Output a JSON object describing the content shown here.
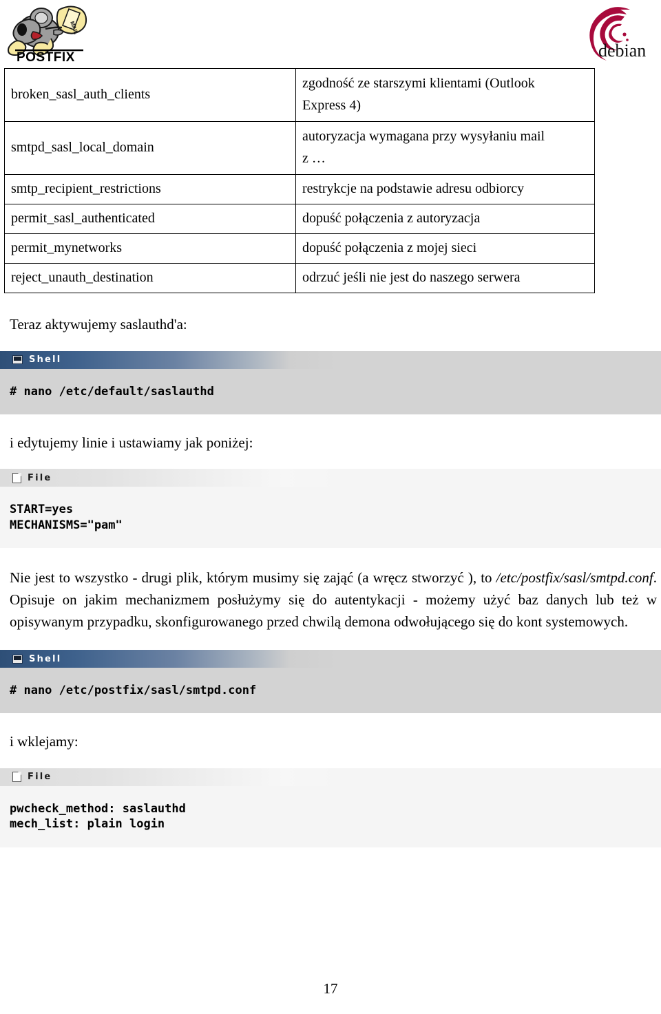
{
  "header": {
    "postfix_logo_alt": "POSTFIX",
    "postfix_wordmark": "POSTFIX",
    "postfix_bag_text": "MAIL",
    "debian_logo_alt": "debian",
    "debian_wordmark": "debian",
    "colors": {
      "debian_red": "#a80a3c",
      "postfix_gray": "#9a9a9a",
      "postfix_yellow": "#f5e08c"
    }
  },
  "table": {
    "rows": [
      {
        "key": "broken_sasl_auth_clients",
        "value_line1": "zgodność ze starszymi klientami (Outlook",
        "value_line2": "Express 4)",
        "tall": true
      },
      {
        "key": "smtpd_sasl_local_domain",
        "value_line1": "autoryzacja wymagana przy wysyłaniu mail",
        "value_line2": "z …",
        "tall": true
      },
      {
        "key": "smtp_recipient_restrictions",
        "value_line1": "restrykcje na podstawie adresu odbiorcy",
        "value_line2": "",
        "tall": false
      },
      {
        "key": "permit_sasl_authenticated",
        "value_line1": "dopuść połączenia z autoryzacja",
        "value_line2": "",
        "tall": false
      },
      {
        "key": "permit_mynetworks",
        "value_line1": "dopuść połączenia z mojej sieci",
        "value_line2": "",
        "tall": false
      },
      {
        "key": "reject_unauth_destination",
        "value_line1": "odrzuć jeśli nie jest do naszego serwera",
        "value_line2": "",
        "tall": false
      }
    ]
  },
  "sections": {
    "intro_saslauthd": "Teraz aktywujemy saslauthd'a:",
    "shell1": {
      "title": "Shell",
      "icon": "monitor-icon",
      "command": "# nano /etc/default/saslauthd"
    },
    "edit_lines": "i edytujemy linie i ustawiamy jak poniżej:",
    "file1": {
      "title": "File",
      "icon": "document-icon",
      "line1": "START=yes",
      "line2": "MECHANISMS=\"pam\""
    },
    "paragraph": {
      "part1": "Nie jest to wszystko - drugi plik, którym musimy się zająć (a wręcz stworzyć ), to ",
      "italic": "/etc/postfix/sasl/smtpd.conf",
      "part2": ". Opisuje on jakim mechanizmem posłużymy się do autentykacji - możemy użyć baz danych lub też w opisywanym przypadku, skonfigurowanego przed chwilą demona odwołującego się do kont systemowych."
    },
    "shell2": {
      "title": "Shell",
      "icon": "monitor-icon",
      "command": "# nano /etc/postfix/sasl/smtpd.conf"
    },
    "paste_label": "i wklejamy:",
    "file2": {
      "title": "File",
      "icon": "document-icon",
      "line1": "pwcheck_method: saslauthd",
      "line2": "mech_list: plain login"
    }
  },
  "footer": {
    "page_number": "17"
  }
}
